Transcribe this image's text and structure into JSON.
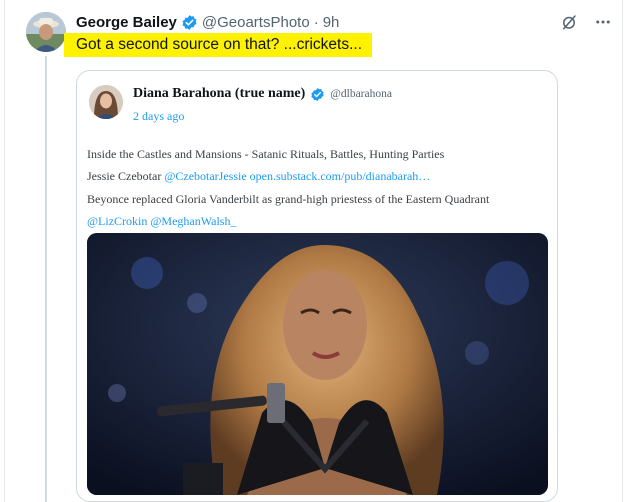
{
  "tweet": {
    "author_name": "George Bailey",
    "handle": "@GeoartsPhoto",
    "separator": "·",
    "time": "9h",
    "text": "Got a second source on that?  ...crickets...",
    "icons": {
      "verified": "verified-badge-icon",
      "grok": "grok-slash-icon",
      "more": "more-dots-icon"
    },
    "highlight_color": "#fff200"
  },
  "quoted": {
    "author_name": "Diana Barahona (true name)",
    "handle": "@dlbarahona",
    "date": "2 days ago",
    "line1": "Inside the Castles and Mansions - Satanic Rituals, Battles, Hunting Parties",
    "line2_prefix": "Jessie Czebotar",
    "line2_mention": "@CzebotarJessie",
    "line2_link": "open.substack.com/pub/dianabarah…",
    "line3": "Beyonce replaced Gloria Vanderbilt as grand-high priestess of the Eastern Quadrant",
    "line4_mention1": "@LizCrokin",
    "line4_mention2": "@MeghanWalsh_",
    "image_icon": "stage-performer-photo"
  },
  "colors": {
    "link": "#1d9bf0",
    "verified": "#1d9bf0",
    "muted": "#536471"
  }
}
